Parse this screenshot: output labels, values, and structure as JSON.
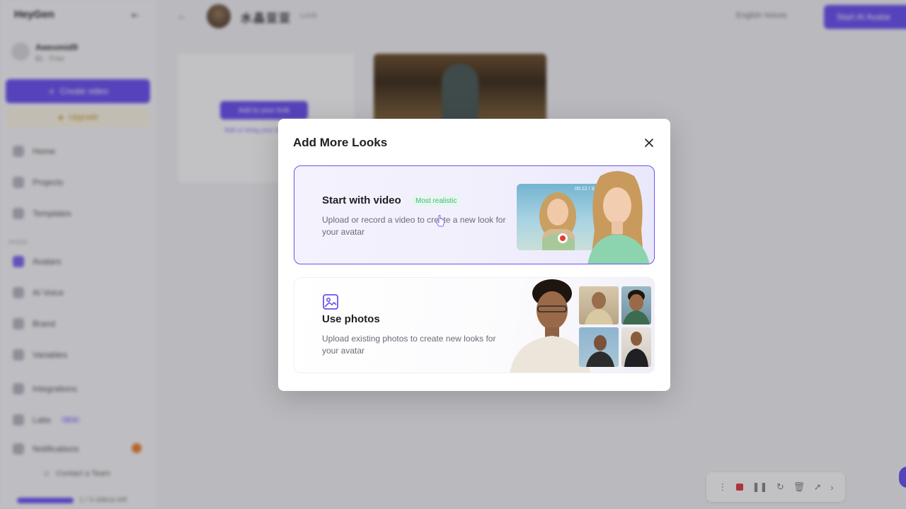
{
  "sidebar": {
    "brand": "HeyGen",
    "workspace_name": "Aweomid9",
    "workspace_plan": "$1 · Free",
    "create_label": "Create video",
    "upgrade_label": "Upgrade",
    "section_label": "Assets",
    "items": [
      {
        "label": "Home"
      },
      {
        "label": "Projects"
      },
      {
        "label": "Templates"
      },
      {
        "label": "Avatars"
      },
      {
        "label": "AI Voice"
      },
      {
        "label": "Brand"
      },
      {
        "label": "Variables"
      },
      {
        "label": "Integrations"
      },
      {
        "label": "Labs",
        "badge": "NEW"
      },
      {
        "label": "Notifications"
      }
    ],
    "support_label": "Contact a Team",
    "credits_label": "1 / 3 videos left"
  },
  "topbar": {
    "title": "水晶亚亚",
    "subtitle": "Look",
    "language": "English Voices",
    "cta_label": "Start AI Avatar"
  },
  "content": {
    "add_look_label": "Add to your look",
    "add_look_sub": "Add or bring your look"
  },
  "modal": {
    "title": "Add More Looks",
    "options": [
      {
        "title": "Start with video",
        "badge": "Most realistic",
        "description": "Upload or record a video to create a new look for your avatar",
        "timer": "00:12 / 3:00"
      },
      {
        "title": "Use photos",
        "description": "Upload existing photos to create new looks for your avatar"
      }
    ]
  },
  "colors": {
    "accent": "#6a55e8",
    "badge_text": "#3fb87f",
    "badge_bg": "#e6f7ee",
    "record_red": "#e53b3b"
  },
  "icons": [
    "close-icon",
    "photo-icon",
    "record-icon",
    "cursor-icon"
  ]
}
